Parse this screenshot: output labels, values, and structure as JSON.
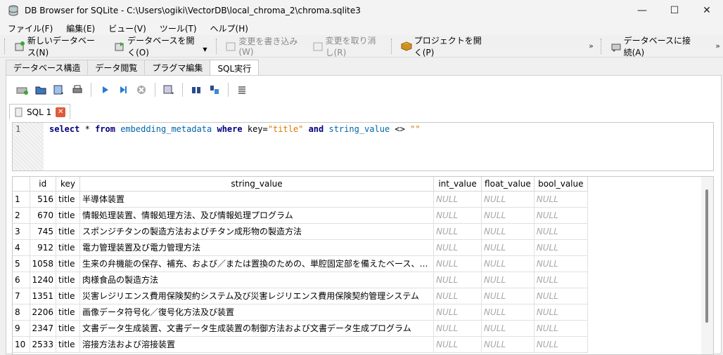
{
  "window": {
    "title": "DB Browser for SQLite - C:\\Users\\ogiki\\VectorDB\\local_chroma_2\\chroma.sqlite3"
  },
  "menu": [
    "ファイル(F)",
    "編集(E)",
    "ビュー(V)",
    "ツール(T)",
    "ヘルプ(H)"
  ],
  "toolbar": {
    "new_db": "新しいデータベース(N)",
    "open_db": "データベースを開く(O)",
    "write_changes": "変更を書き込み(W)",
    "revert_changes": "変更を取り消し(R)",
    "open_project": "プロジェクトを開く(P)",
    "overflow": "»",
    "connect_db": "データベースに接続(A)"
  },
  "tabs": [
    "データベース構造",
    "データ閲覧",
    "プラグマ編集",
    "SQL実行"
  ],
  "sql_tab": {
    "label": "SQL 1",
    "close": "✕"
  },
  "editor": {
    "line_no": "1",
    "kw_select": "select",
    "star": "*",
    "kw_from": "from",
    "table": "embedding_metadata",
    "kw_where": "where",
    "cond1": "key=",
    "str_title": "\"title\"",
    "kw_and": "and",
    "col": "string_value",
    "op": "<>",
    "str_empty": "\"\""
  },
  "grid": {
    "headers": [
      "",
      "id",
      "key",
      "string_value",
      "int_value",
      "float_value",
      "bool_value"
    ],
    "null_text": "NULL",
    "rows": [
      {
        "n": "1",
        "id": "516",
        "key": "title",
        "sv": "半導体装置"
      },
      {
        "n": "2",
        "id": "670",
        "key": "title",
        "sv": "情報処理装置、情報処理方法、及び情報処理プログラム"
      },
      {
        "n": "3",
        "id": "745",
        "key": "title",
        "sv": "スポンジチタンの製造方法およびチタン成形物の製造方法"
      },
      {
        "n": "4",
        "id": "912",
        "key": "title",
        "sv": "電力管理装置及び電力管理方法"
      },
      {
        "n": "5",
        "id": "1058",
        "key": "title",
        "sv": "生来の弁機能の保存、補充、および／または置換のための、単腔固定部を備えたベース、ば…"
      },
      {
        "n": "6",
        "id": "1240",
        "key": "title",
        "sv": "肉様食品の製造方法"
      },
      {
        "n": "7",
        "id": "1351",
        "key": "title",
        "sv": "災害レジリエンス費用保険契約システム及び災害レジリエンス費用保険契約管理システム"
      },
      {
        "n": "8",
        "id": "2206",
        "key": "title",
        "sv": "画像データ符号化／復号化方法及び装置"
      },
      {
        "n": "9",
        "id": "2347",
        "key": "title",
        "sv": "文書データ生成装置、文書データ生成装置の制御方法および文書データ生成プログラム"
      },
      {
        "n": "10",
        "id": "2533",
        "key": "title",
        "sv": "溶接方法および溶接装置"
      }
    ]
  }
}
